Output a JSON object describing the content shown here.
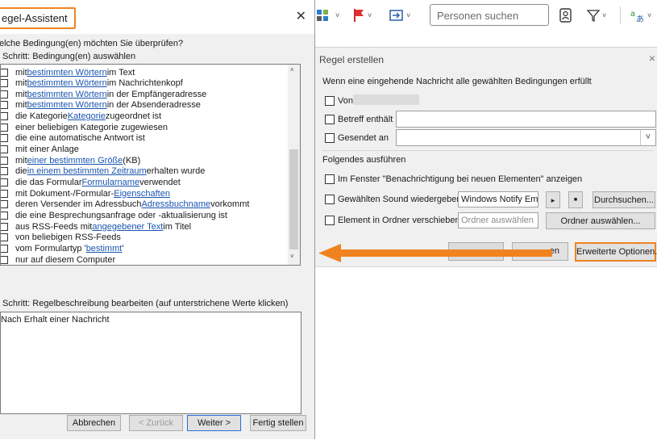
{
  "toolbar": {
    "search_placeholder": "Personen suchen",
    "icons": [
      "view-grid-icon",
      "flag-icon",
      "move-folder-icon",
      "contact-card-icon",
      "filter-icon",
      "translate-icon"
    ]
  },
  "rule_dialog": {
    "title": "Regel erstellen",
    "close": "×",
    "cond_heading": "Wenn eine eingehende Nachricht alle gewählten Bedingungen erfüllt",
    "from_label": "Von",
    "subject_label": "Betreff enthält",
    "sent_to_label": "Gesendet an",
    "actions_heading": "Folgendes ausführen",
    "show_alert_label": "Im Fenster \"Benachrichtigung bei neuen Elementen\" anzeigen",
    "sound_label": "Gewählten Sound wiedergeben:",
    "sound_value": "Windows Notify Email.",
    "play_symbol": "▸",
    "stop_symbol": "■",
    "browse_label": "Durchsuchen...",
    "move_label": "Element in Ordner verschieben:",
    "folder_placeholder": "Ordner auswählen",
    "choose_folder_label": "Ordner auswählen...",
    "cancel_partial": "en",
    "advanced_label": "Erweiterte Optionen..."
  },
  "wizard": {
    "title": "egel-Assistent",
    "close": "✕",
    "question": "elche Bedingung(en) möchten Sie überprüfen?",
    "step1": "Schritt: Bedingung(en) auswählen",
    "conditions": [
      {
        "pre": "mit ",
        "link": "bestimmten Wörtern",
        "post": " im Text"
      },
      {
        "pre": "mit ",
        "link": "bestimmten Wörtern",
        "post": " im Nachrichtenkopf"
      },
      {
        "pre": "mit ",
        "link": "bestimmten Wörtern",
        "post": " in der Empfängeradresse"
      },
      {
        "pre": "mit ",
        "link": "bestimmten Wörtern",
        "post": " in der Absenderadresse"
      },
      {
        "pre": "die Kategorie ",
        "link": "Kategorie",
        "post": " zugeordnet ist"
      },
      {
        "pre": "einer beliebigen Kategorie zugewiesen",
        "link": "",
        "post": ""
      },
      {
        "pre": "die eine automatische Antwort ist",
        "link": "",
        "post": ""
      },
      {
        "pre": "mit einer Anlage",
        "link": "",
        "post": ""
      },
      {
        "pre": "mit ",
        "link": "einer bestimmten Größe",
        "post": " (KB)"
      },
      {
        "pre": "die ",
        "link": "in einem bestimmten Zeitraum",
        "post": " erhalten wurde"
      },
      {
        "pre": "die das Formular ",
        "link": "Formularname",
        "post": " verwendet"
      },
      {
        "pre": "mit Dokument-/Formular-",
        "link": "Eigenschaften",
        "post": ""
      },
      {
        "pre": "deren Versender im Adressbuch ",
        "link": "Adressbuchname",
        "post": " vorkommt"
      },
      {
        "pre": "die eine Besprechungsanfrage oder -aktualisierung ist",
        "link": "",
        "post": ""
      },
      {
        "pre": "aus RSS-Feeds mit ",
        "link": "angegebener Text",
        "post": " im Titel"
      },
      {
        "pre": "von beliebigen RSS-Feeds",
        "link": "",
        "post": ""
      },
      {
        "pre": "vom Formulartyp '",
        "link": "bestimmt",
        "post": "'"
      },
      {
        "pre": "nur auf diesem Computer",
        "link": "",
        "post": ""
      }
    ],
    "step2": "Schritt: Regelbeschreibung bearbeiten (auf unterstrichene Werte klicken)",
    "description": "Nach Erhalt einer Nachricht",
    "buttons": {
      "cancel": "Abbrechen",
      "back": "< Zurück",
      "next": "Weiter >",
      "finish": "Fertig stellen"
    }
  },
  "colors": {
    "accent_orange": "#f0831f",
    "link_blue": "#1a55b0",
    "dialog_bg": "#f0f0f0"
  }
}
